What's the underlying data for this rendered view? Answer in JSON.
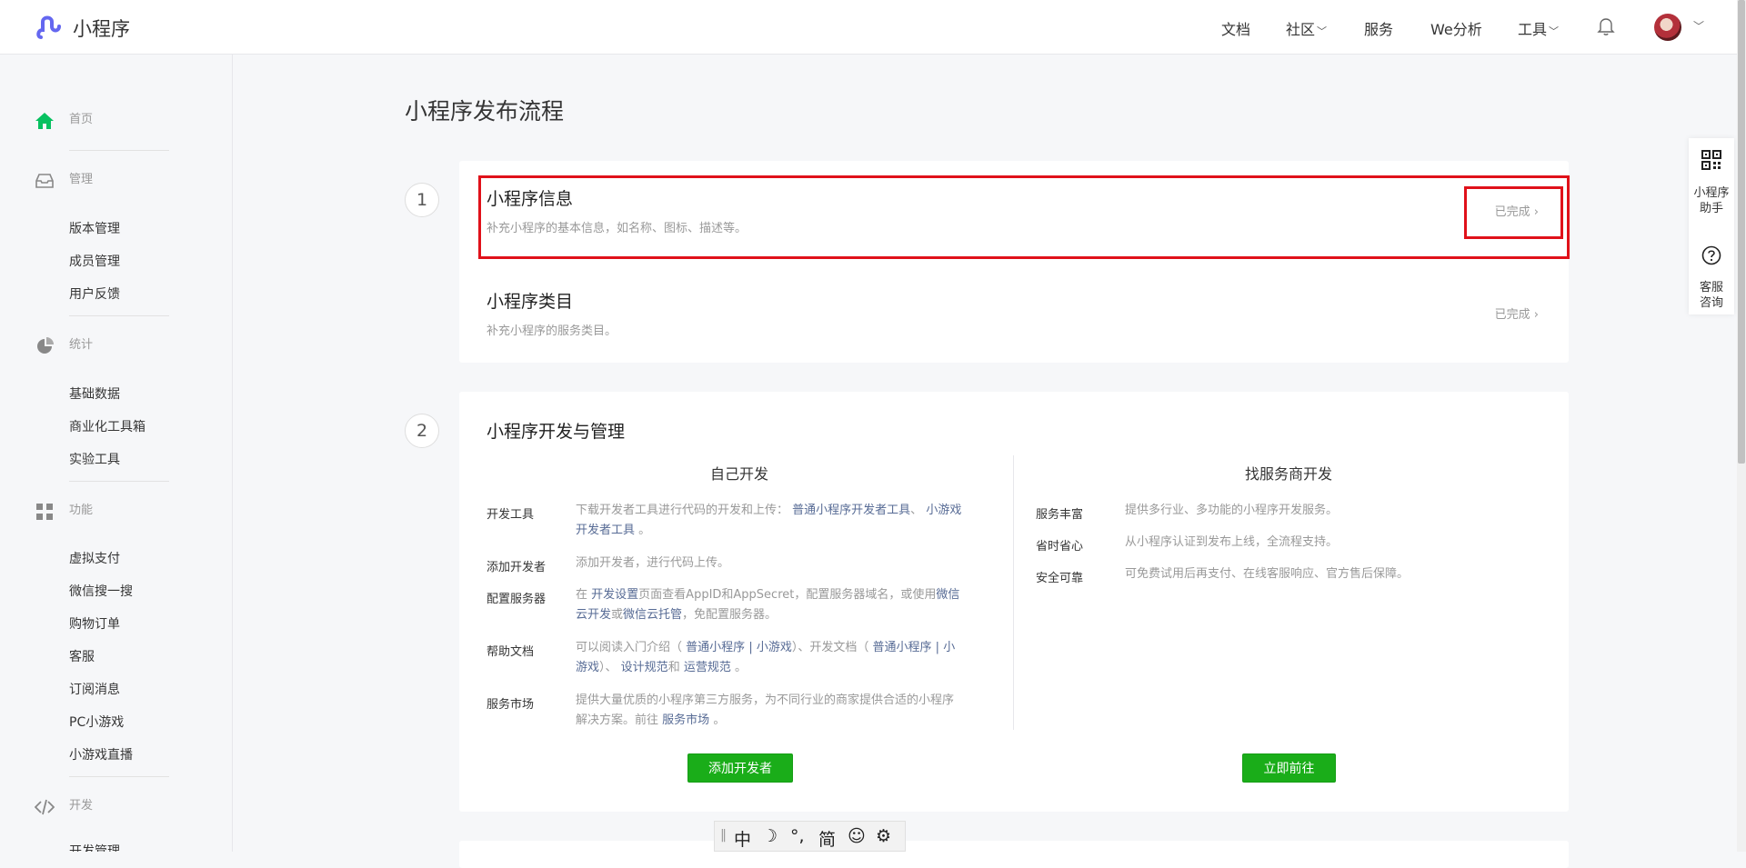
{
  "header": {
    "app_name": "小程序",
    "nav": [
      {
        "label": "文档",
        "has_dropdown": false
      },
      {
        "label": "社区",
        "has_dropdown": true
      },
      {
        "label": "服务",
        "has_dropdown": false
      },
      {
        "label": "We分析",
        "has_dropdown": false
      },
      {
        "label": "工具",
        "has_dropdown": true
      }
    ]
  },
  "sidebar": {
    "home": "首页",
    "sections": [
      {
        "title": "管理",
        "items": [
          "版本管理",
          "成员管理",
          "用户反馈"
        ]
      },
      {
        "title": "统计",
        "items": [
          "基础数据",
          "商业化工具箱",
          "实验工具"
        ]
      },
      {
        "title": "功能",
        "items": [
          "虚拟支付",
          "微信搜一搜",
          "购物订单",
          "客服",
          "订阅消息",
          "PC小游戏",
          "小游戏直播"
        ]
      },
      {
        "title": "开发",
        "items": [
          "开发管理"
        ]
      }
    ]
  },
  "main": {
    "title": "小程序发布流程",
    "step1": {
      "number": "1",
      "rows": [
        {
          "title": "小程序信息",
          "desc": "补充小程序的基本信息，如名称、图标、描述等。",
          "status": "已完成"
        },
        {
          "title": "小程序类目",
          "desc": "补充小程序的服务类目。",
          "status": "已完成"
        }
      ]
    },
    "step2": {
      "number": "2",
      "title": "小程序开发与管理",
      "self_dev": {
        "heading": "自己开发",
        "dev_tools": {
          "label": "开发工具",
          "text1": "下载开发者工具进行代码的开发和上传：",
          "link1": "普通小程序开发者工具",
          "sep": "、",
          "link2a": "小游戏",
          "link2b": "开发者工具",
          "end": "。"
        },
        "add_dev": {
          "label": "添加开发者",
          "text": "添加开发者，进行代码上传。"
        },
        "server": {
          "label": "配置服务器",
          "t1": "在",
          "link1": "开发设置",
          "t2": "页面查看AppID和AppSecret，配置服务器域名，或使用",
          "link2a": "微信",
          "link2b": "云开发",
          "t3": "或",
          "link3": "微信云托管",
          "t4": "，免配置服务器。"
        },
        "help": {
          "label": "帮助文档",
          "t1": "可以阅读入门介绍（",
          "l1": "普通小程序",
          "sep1": "|",
          "l2": "小游戏",
          "t2": "）、开发文档（",
          "l3": "普通小程序",
          "sep2": "|",
          "l4a": "小",
          "l4b": "游戏",
          "t3": "）、",
          "l5": "设计规范",
          "t4": "和",
          "l6": "运营规范",
          "t5": "。"
        },
        "market": {
          "label": "服务市场",
          "t1": "提供大量优质的小程序第三方服务，为不同行业的商家提供合适的小程序",
          "t2": "解决方案。前往",
          "l1": "服务市场",
          "t3": "。"
        },
        "button": "添加开发者"
      },
      "vendor_dev": {
        "heading": "找服务商开发",
        "items": [
          {
            "label": "服务丰富",
            "text": "提供多行业、多功能的小程序开发服务。"
          },
          {
            "label": "省时省心",
            "text": "从小程序认证到发布上线，全流程支持。"
          },
          {
            "label": "安全可靠",
            "text": "可免费试用后再支付、在线客服响应、官方售后保障。"
          }
        ],
        "button": "立即前往"
      }
    }
  },
  "right_float": {
    "assistant": [
      "小程序",
      "助手"
    ],
    "service": [
      "客服",
      "咨询"
    ]
  },
  "ime_toolbar": {
    "mode": "中",
    "punct": "°,",
    "script": "简"
  },
  "colors": {
    "brand_green": "#07c160",
    "button_green": "#1aad19",
    "link": "#576b95",
    "highlight": "#e0111a",
    "logo": "#6467f0"
  }
}
